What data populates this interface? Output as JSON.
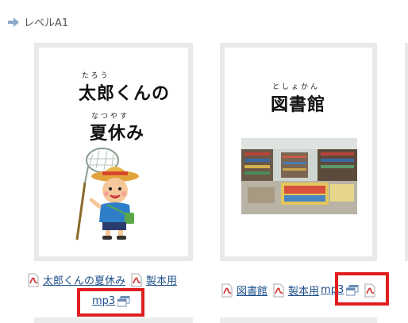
{
  "section": {
    "title": "レベルA1"
  },
  "books": [
    {
      "title_ruby": "たろう",
      "title_line1": "太郎くんの",
      "title_ruby2": "なつやす",
      "title_line2": "夏休み",
      "link_label": "太郎くんの夏休み",
      "bind_label": "製本用",
      "mp3_label": "mp3"
    },
    {
      "title_ruby": "としょかん",
      "title_line1": "図書館",
      "link_label": "図書館",
      "bind_label": "製本用",
      "mp3_label": "mp3"
    }
  ],
  "icons": {
    "pdf": "pdf-icon",
    "new_window": "new-window-icon",
    "arrow": "arrow-right-icon"
  },
  "colors": {
    "link": "#1d4f8a",
    "highlight_box": "#e01e1e",
    "card_border": "#e9e9e9",
    "pdf_red": "#d32f2f"
  }
}
